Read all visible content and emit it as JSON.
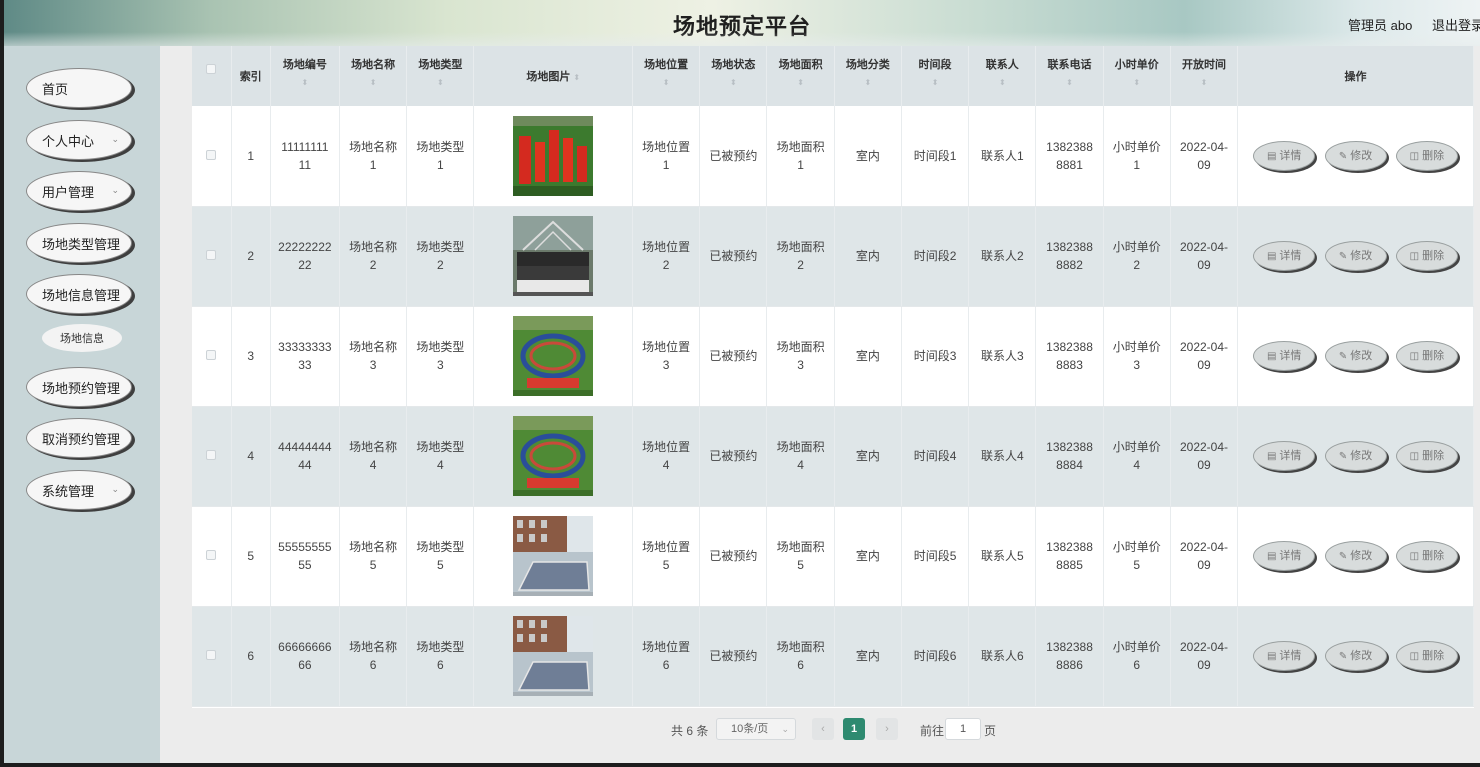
{
  "header": {
    "title": "场地预定平台",
    "user_label": "管理员 abo",
    "logout_label": "退出登录"
  },
  "sidebar": {
    "items": [
      {
        "label": "首页",
        "has_arrow": false
      },
      {
        "label": "个人中心",
        "has_arrow": true
      },
      {
        "label": "用户管理",
        "has_arrow": true
      },
      {
        "label": "场地类型管理",
        "has_arrow": false
      },
      {
        "label": "场地信息管理",
        "has_arrow": false
      },
      {
        "label": "场地信息",
        "sub": true
      },
      {
        "label": "场地预约管理",
        "has_arrow": false
      },
      {
        "label": "取消预约管理",
        "has_arrow": false
      },
      {
        "label": "系统管理",
        "has_arrow": true
      }
    ]
  },
  "table": {
    "columns": [
      "索引",
      "场地编号",
      "场地名称",
      "场地类型",
      "场地图片",
      "场地位置",
      "场地状态",
      "场地面积",
      "场地分类",
      "时间段",
      "联系人",
      "联系电话",
      "小时单价",
      "开放时间",
      "操作"
    ],
    "rows": [
      {
        "index": "1",
        "code": [
          "11111111",
          "11"
        ],
        "name": [
          "场地名称",
          "1"
        ],
        "type": [
          "场地类型",
          "1"
        ],
        "image": "crowd-formation",
        "location": [
          "场地位置",
          "1"
        ],
        "status": "已被预约",
        "area": [
          "场地面积",
          "1"
        ],
        "category": "室内",
        "period": "时间段1",
        "contact": "联系人1",
        "phone": [
          "1382388",
          "8881"
        ],
        "price": [
          "小时单价",
          "1"
        ],
        "open_time": [
          "2022-04-",
          "09"
        ]
      },
      {
        "index": "2",
        "code": [
          "22222222",
          "22"
        ],
        "name": [
          "场地名称",
          "2"
        ],
        "type": [
          "场地类型",
          "2"
        ],
        "image": "group-photo",
        "location": [
          "场地位置",
          "2"
        ],
        "status": "已被预约",
        "area": [
          "场地面积",
          "2"
        ],
        "category": "室内",
        "period": "时间段2",
        "contact": "联系人2",
        "phone": [
          "1382388",
          "8882"
        ],
        "price": [
          "小时单价",
          "2"
        ],
        "open_time": [
          "2022-04-",
          "09"
        ]
      },
      {
        "index": "3",
        "code": [
          "33333333",
          "33"
        ],
        "name": [
          "场地名称",
          "3"
        ],
        "type": [
          "场地类型",
          "3"
        ],
        "image": "crowd-circle",
        "location": [
          "场地位置",
          "3"
        ],
        "status": "已被预约",
        "area": [
          "场地面积",
          "3"
        ],
        "category": "室内",
        "period": "时间段3",
        "contact": "联系人3",
        "phone": [
          "1382388",
          "8883"
        ],
        "price": [
          "小时单价",
          "3"
        ],
        "open_time": [
          "2022-04-",
          "09"
        ]
      },
      {
        "index": "4",
        "code": [
          "44444444",
          "44"
        ],
        "name": [
          "场地名称",
          "4"
        ],
        "type": [
          "场地类型",
          "4"
        ],
        "image": "crowd-circle",
        "location": [
          "场地位置",
          "4"
        ],
        "status": "已被预约",
        "area": [
          "场地面积",
          "4"
        ],
        "category": "室内",
        "period": "时间段4",
        "contact": "联系人4",
        "phone": [
          "1382388",
          "8884"
        ],
        "price": [
          "小时单价",
          "4"
        ],
        "open_time": [
          "2022-04-",
          "09"
        ]
      },
      {
        "index": "5",
        "code": [
          "55555555",
          "55"
        ],
        "name": [
          "场地名称",
          "5"
        ],
        "type": [
          "场地类型",
          "5"
        ],
        "image": "building-court",
        "location": [
          "场地位置",
          "5"
        ],
        "status": "已被预约",
        "area": [
          "场地面积",
          "5"
        ],
        "category": "室内",
        "period": "时间段5",
        "contact": "联系人5",
        "phone": [
          "1382388",
          "8885"
        ],
        "price": [
          "小时单价",
          "5"
        ],
        "open_time": [
          "2022-04-",
          "09"
        ]
      },
      {
        "index": "6",
        "code": [
          "66666666",
          "66"
        ],
        "name": [
          "场地名称",
          "6"
        ],
        "type": [
          "场地类型",
          "6"
        ],
        "image": "building-court",
        "location": [
          "场地位置",
          "6"
        ],
        "status": "已被预约",
        "area": [
          "场地面积",
          "6"
        ],
        "category": "室内",
        "period": "时间段6",
        "contact": "联系人6",
        "phone": [
          "1382388",
          "8886"
        ],
        "price": [
          "小时单价",
          "6"
        ],
        "open_time": [
          "2022-04-",
          "09"
        ]
      }
    ],
    "actions": {
      "detail": "详情",
      "edit": "修改",
      "delete": "删除"
    }
  },
  "pagination": {
    "total": "共 6 条",
    "page_size": "10条/页",
    "current": "1",
    "goto_label": "前往",
    "goto_value": "1",
    "unit": "页",
    "prev": "‹",
    "next": "›"
  },
  "colors": {
    "accent": "#2e8a70",
    "row_alt": "#dfe6e8",
    "sidebar": "#c8d6d8"
  }
}
